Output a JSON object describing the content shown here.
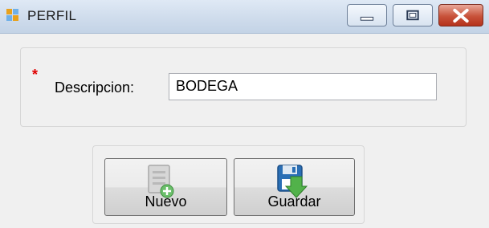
{
  "window": {
    "title": "PERFIL",
    "icon": "app-window-icon",
    "controls": [
      "minimize-icon",
      "maximize-icon",
      "close-icon"
    ]
  },
  "form": {
    "required_marker": "*",
    "descripcion_label": "Descripcion:",
    "descripcion_value": "BODEGA"
  },
  "actions": {
    "nuevo_label": "Nuevo",
    "nuevo_icon": "new-document-icon",
    "guardar_label": "Guardar",
    "guardar_icon": "save-icon"
  },
  "colors": {
    "required": "#e00000",
    "close_button": "#c8523a",
    "titlebar": "#cfdcec"
  }
}
